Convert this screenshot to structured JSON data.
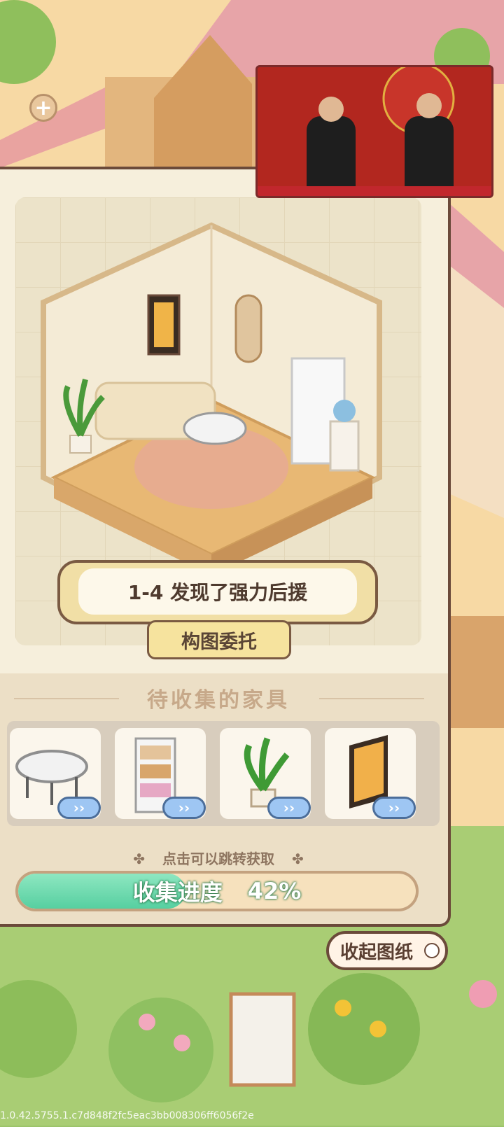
{
  "level": {
    "title": "1-4 发现了强力后援"
  },
  "task_tab": {
    "label": "构图委托"
  },
  "furniture_section": {
    "title": "待收集的家具",
    "items": [
      {
        "name": "round-glass-table",
        "arrow": "››"
      },
      {
        "name": "white-bookshelf",
        "arrow": "››"
      },
      {
        "name": "potted-plant",
        "arrow": "››"
      },
      {
        "name": "wall-painting",
        "arrow": "››"
      }
    ],
    "hint": "点击可以跳转获取",
    "hint_icon": "✤"
  },
  "progress": {
    "label": "收集进度",
    "value_text": "42%",
    "value": 0.42
  },
  "collapse_button": {
    "label": "收起图纸"
  },
  "plus_button": {
    "label": "+"
  },
  "version": "1.0.42.5755.1.c7d848f2fc5eac3bb008306ff6056f2e",
  "colors": {
    "panel": "#f6efdc",
    "border": "#6b4a3a",
    "progress_fill": "#56cfa0",
    "arrow_btn": "#9ec6f3"
  }
}
